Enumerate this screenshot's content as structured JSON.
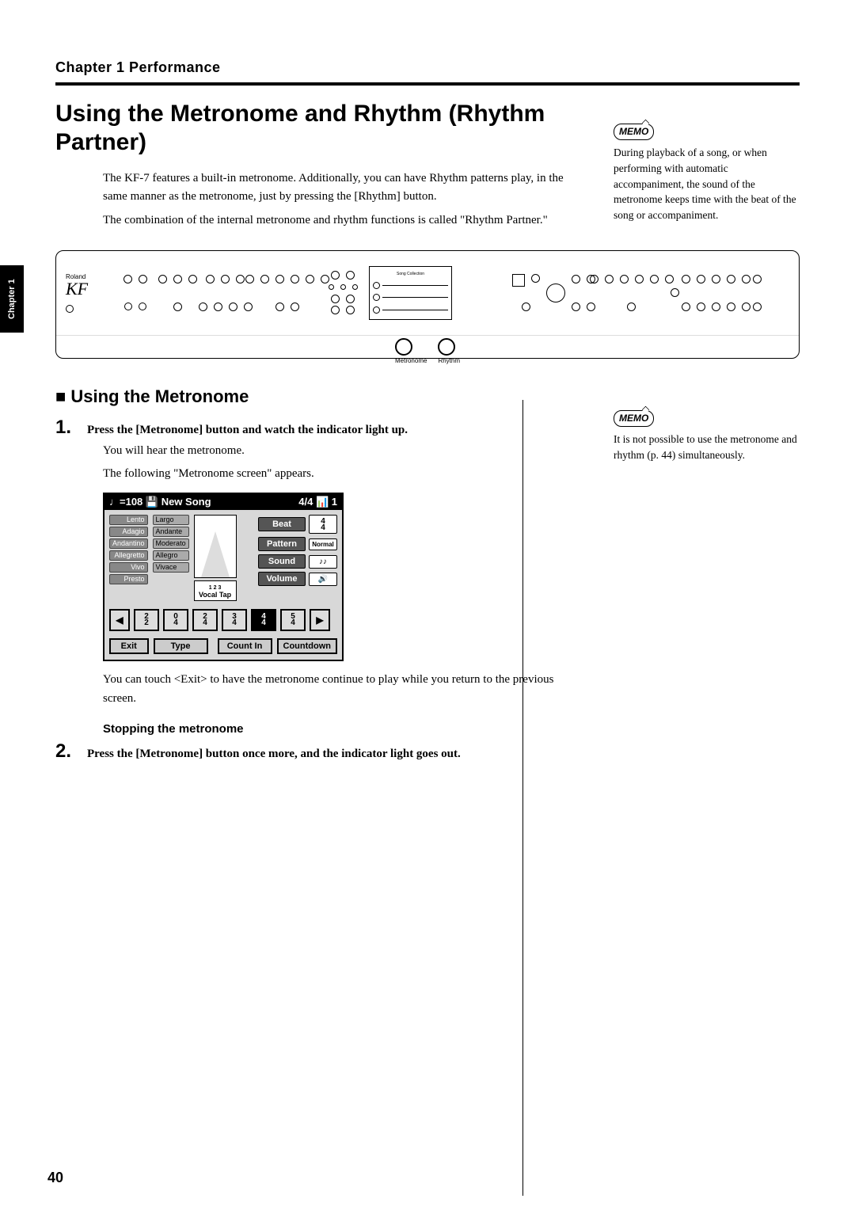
{
  "header": {
    "chapter_line": "Chapter 1 Performance",
    "title": "Using the Metronome and Rhythm (Rhythm Partner)"
  },
  "side_tab": "Chapter 1",
  "intro": {
    "p1": "The KF-7 features a built-in metronome. Additionally, you can have Rhythm patterns play, in the same manner as the metronome, just by pressing the [Rhythm] button.",
    "p2": "The combination of the internal metronome and rhythm functions is called \"Rhythm Partner.\""
  },
  "memo1": {
    "label": "MEMO",
    "text": "During playback of a song, or when performing with automatic accompaniment, the sound of the metronome keeps time with the beat of the song or accompaniment."
  },
  "panel": {
    "brand": "Roland",
    "model": "KF",
    "knob_metronome": "Metronome",
    "knob_rhythm": "Rhythm",
    "lcd_title": "Song Collection"
  },
  "section1": {
    "heading": "■ Using the Metronome",
    "step1_num": "1.",
    "step1_text": "Press the [Metronome] button and watch the indicator light up.",
    "after1a": "You will hear the metronome.",
    "after1b": "The following \"Metronome screen\" appears.",
    "after_screen": "You can touch <Exit> to have the metronome continue to play while you return to the previous screen.",
    "sub_heading": "Stopping the metronome",
    "step2_num": "2.",
    "step2_text": "Press the [Metronome] button once more, and the indicator light goes out."
  },
  "memo2": {
    "label": "MEMO",
    "text": "It is not possible to use the metronome and rhythm (p. 44) simultaneously."
  },
  "screen": {
    "bar_left": "♩=108 💾 New Song",
    "bar_right": "4/4 📊 1",
    "tempos_left": [
      "Lento",
      "Adagio",
      "Andantino",
      "Allegretto",
      "Vivo",
      "Presto"
    ],
    "tempos_right": [
      "Largo",
      "Andante",
      "Moderato",
      "Allegro",
      "Vivace"
    ],
    "vocal": "Vocal Tap",
    "beat_label": "Beat",
    "beat_val_top": "4",
    "beat_val_bot": "4",
    "pattern_label": "Pattern",
    "pattern_val": "Normal",
    "sound_label": "Sound",
    "volume_label": "Volume",
    "ts": [
      "2/2",
      "0/4",
      "2/4",
      "3/4",
      "4/4",
      "5/4"
    ],
    "ts_sel_index": 4,
    "btn_exit": "Exit",
    "btn_type": "Type",
    "btn_countin": "Count In",
    "btn_countdown": "Countdown"
  },
  "page_number": "40"
}
